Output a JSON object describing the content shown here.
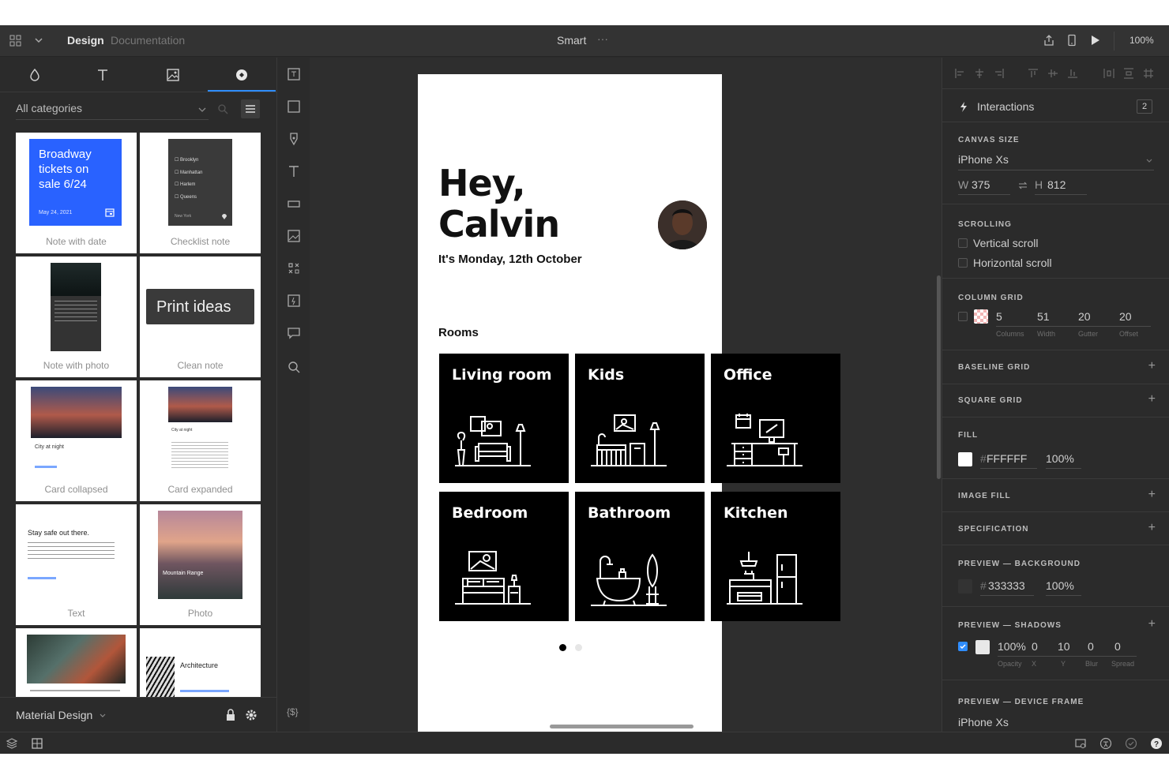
{
  "topbar": {
    "mode_active": "Design",
    "mode_inactive": "Documentation",
    "document_title": "Smart",
    "more": "···",
    "zoom": "100%"
  },
  "left_panel": {
    "category": "All categories",
    "library_name": "Material Design",
    "tiles": [
      {
        "caption": "Note with date",
        "card_text": "Broadway tickets on sale 6/24",
        "card_date": "May 24, 2021"
      },
      {
        "caption": "Checklist note",
        "items": [
          "Brooklyn",
          "Manhattan",
          "Harlem",
          "Queens"
        ],
        "location": "New York"
      },
      {
        "caption": "Note with photo"
      },
      {
        "caption": "Clean note",
        "card_text": "Print ideas"
      },
      {
        "caption": "Card collapsed",
        "card_title": "City at night"
      },
      {
        "caption": "Card expanded",
        "card_title": "City at night"
      },
      {
        "caption": "Text",
        "card_title": "Stay safe out there."
      },
      {
        "caption": "Photo",
        "card_title": "Mountain Range"
      },
      {
        "caption": ""
      },
      {
        "caption": "",
        "card_title": "Architecture"
      }
    ]
  },
  "tools": {
    "variables_label": "{$}"
  },
  "phone": {
    "greeting_line1": "Hey,",
    "greeting_line2": "Calvin",
    "date": "It's Monday, 12th October",
    "rooms_heading": "Rooms",
    "rooms": [
      "Living room",
      "Kids",
      "Office",
      "Bedroom",
      "Bathroom",
      "Kitchen"
    ],
    "page_dots": {
      "count": 2,
      "active": 1
    }
  },
  "right_panel": {
    "interactions_label": "Interactions",
    "interactions_count": "2",
    "canvas_size": {
      "heading": "CANVAS SIZE",
      "device": "iPhone Xs",
      "w_label": "W",
      "w": "375",
      "h_label": "H",
      "h": "812"
    },
    "scrolling": {
      "heading": "SCROLLING",
      "vertical": "Vertical scroll",
      "horizontal": "Horizontal scroll"
    },
    "column_grid": {
      "heading": "COLUMN GRID",
      "columns": "5",
      "columns_label": "Columns",
      "width": "51",
      "width_label": "Width",
      "gutter": "20",
      "gutter_label": "Gutter",
      "offset": "20",
      "offset_label": "Offset"
    },
    "baseline_grid": "BASELINE GRID",
    "square_grid": "SQUARE GRID",
    "fill": {
      "heading": "FILL",
      "hex": "FFFFFF",
      "opacity": "100%",
      "color": "#FFFFFF"
    },
    "image_fill": "IMAGE FILL",
    "specification": "SPECIFICATION",
    "preview_background": {
      "heading": "PREVIEW — BACKGROUND",
      "hex": "333333",
      "opacity": "100%",
      "color": "#333333"
    },
    "preview_shadows": {
      "heading": "PREVIEW — SHADOWS",
      "opacity": "100%",
      "opacity_label": "Opacity",
      "x": "0",
      "x_label": "X",
      "y": "10",
      "y_label": "Y",
      "blur": "0",
      "blur_label": "Blur",
      "spread": "0",
      "spread_label": "Spread"
    },
    "preview_device_frame": {
      "heading": "PREVIEW — DEVICE FRAME",
      "device": "iPhone Xs"
    },
    "hash": "#",
    "plus": "+"
  },
  "colors": {
    "accent": "#2f8dff",
    "panel": "#2b2b2b",
    "card_blue": "#2962ff"
  }
}
